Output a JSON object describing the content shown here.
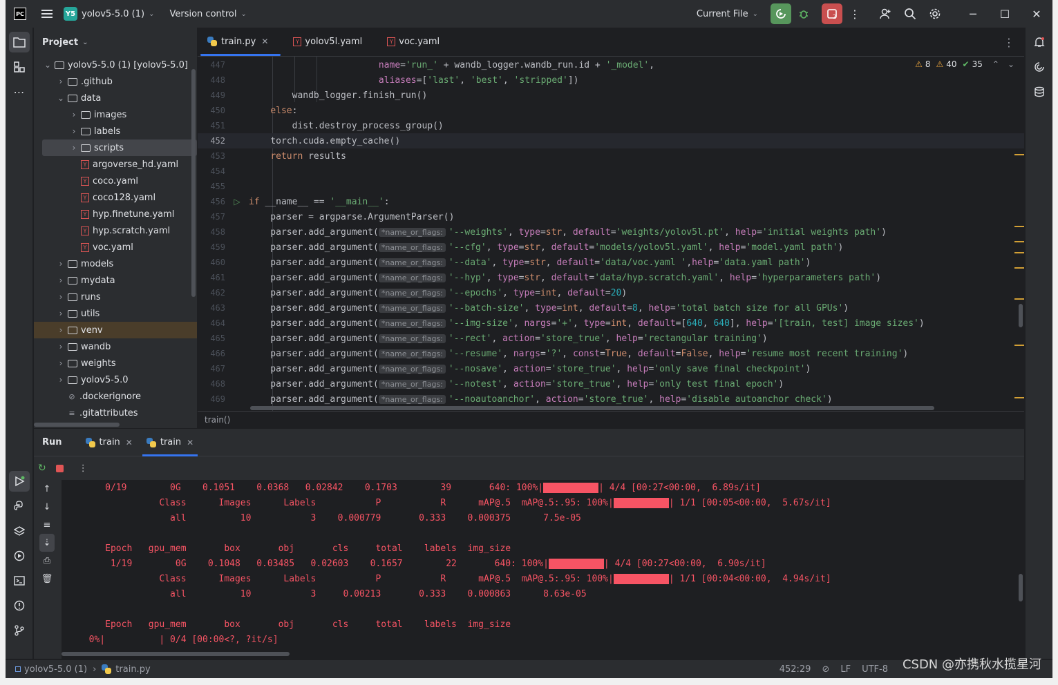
{
  "titlebar": {
    "project_badge": "Y5",
    "project_name": "yolov5-5.0 (1)",
    "vcs": "Version control",
    "run_config": "Current File"
  },
  "project_panel": {
    "title": "Project",
    "tree": [
      {
        "label": "yolov5-5.0 (1)  [yolov5-5.0]",
        "type": "folder",
        "level": 0,
        "expanded": true
      },
      {
        "label": ".github",
        "type": "folder",
        "level": 1
      },
      {
        "label": "data",
        "type": "folder",
        "level": 1,
        "expanded": true
      },
      {
        "label": "images",
        "type": "folder",
        "level": 2
      },
      {
        "label": "labels",
        "type": "folder",
        "level": 2
      },
      {
        "label": "scripts",
        "type": "folder",
        "level": 2,
        "selected": true
      },
      {
        "label": "argoverse_hd.yaml",
        "type": "yaml",
        "level": 2
      },
      {
        "label": "coco.yaml",
        "type": "yaml",
        "level": 2
      },
      {
        "label": "coco128.yaml",
        "type": "yaml",
        "level": 2
      },
      {
        "label": "hyp.finetune.yaml",
        "type": "yaml",
        "level": 2
      },
      {
        "label": "hyp.scratch.yaml",
        "type": "yaml",
        "level": 2
      },
      {
        "label": "voc.yaml",
        "type": "yaml",
        "level": 2
      },
      {
        "label": "models",
        "type": "folder",
        "level": 1
      },
      {
        "label": "mydata",
        "type": "folder",
        "level": 1
      },
      {
        "label": "runs",
        "type": "folder",
        "level": 1
      },
      {
        "label": "utils",
        "type": "folder",
        "level": 1
      },
      {
        "label": "venv",
        "type": "folder",
        "level": 1,
        "venv": true
      },
      {
        "label": "wandb",
        "type": "folder",
        "level": 1
      },
      {
        "label": "weights",
        "type": "folder",
        "level": 1
      },
      {
        "label": "yolov5-5.0",
        "type": "folder",
        "level": 1
      },
      {
        "label": ".dockerignore",
        "type": "ignore",
        "level": 1
      },
      {
        "label": ".gitattributes",
        "type": "text",
        "level": 1
      }
    ]
  },
  "editor": {
    "tabs": [
      {
        "label": "train.py",
        "kind": "py",
        "active": true
      },
      {
        "label": "yolov5l.yaml",
        "kind": "yaml"
      },
      {
        "label": "voc.yaml",
        "kind": "yaml"
      }
    ],
    "inspections": {
      "warnings1": "8",
      "warnings2": "40",
      "ok": "35"
    },
    "current_line": "452",
    "breadcrumb": "train()",
    "hint_label": "*name_or_flags:",
    "lines": [
      {
        "n": "447",
        "html": "                        <span class='param'>name</span>=<span class='str'>'run_'</span> + wandb_logger.wandb_run.id + <span class='str'>'_model'</span>,"
      },
      {
        "n": "448",
        "html": "                        <span class='param'>aliases</span>=[<span class='str'>'last'</span>, <span class='str'>'best'</span>, <span class='str'>'stripped'</span>])"
      },
      {
        "n": "449",
        "html": "        wandb_logger.finish_run()"
      },
      {
        "n": "450",
        "html": "    <span class='kw'>else</span>:"
      },
      {
        "n": "451",
        "html": "        dist.destroy_process_group()"
      },
      {
        "n": "452",
        "html": "    torch.cuda.empty_cache()"
      },
      {
        "n": "453",
        "html": "    <span class='kw'>return</span> results"
      },
      {
        "n": "454",
        "html": ""
      },
      {
        "n": "455",
        "html": ""
      },
      {
        "n": "456",
        "html": "<span class='kw'>if</span> __name__ == <span class='str'>'__main__'</span>:",
        "run": true
      },
      {
        "n": "457",
        "html": "    parser = argparse.ArgumentParser()"
      },
      {
        "n": "458",
        "hint": true,
        "html": "<span class='str'>'--weights'</span>, <span class='param'>type</span>=<span class='kw'>str</span>, <span class='param'>default</span>=<span class='str'>'weights/yolov5l.pt'</span>, <span class='param'>help</span>=<span class='str'>'initial weights path'</span>)"
      },
      {
        "n": "459",
        "hint": true,
        "html": "<span class='str'>'--cfg'</span>, <span class='param'>type</span>=<span class='kw'>str</span>, <span class='param'>default</span>=<span class='str'>'models/yolov5l.yaml'</span>, <span class='param'>help</span>=<span class='str'>'model.yaml path'</span>)"
      },
      {
        "n": "460",
        "hint": true,
        "html": "<span class='str'>'--data'</span>, <span class='param'>type</span>=<span class='kw'>str</span>, <span class='param'>default</span>=<span class='str'>'data/voc.yaml '</span>,<span class='param'>help</span>=<span class='str'>'data.yaml path'</span>)"
      },
      {
        "n": "461",
        "hint": true,
        "html": "<span class='str'>'--hyp'</span>, <span class='param'>type</span>=<span class='kw'>str</span>, <span class='param'>default</span>=<span class='str'>'data/hyp.scratch.yaml'</span>, <span class='param'>help</span>=<span class='str'>'hyperparameters path'</span>)"
      },
      {
        "n": "462",
        "hint": true,
        "html": "<span class='str'>'--epochs'</span>, <span class='param'>type</span>=<span class='kw'>int</span>, <span class='param'>default</span>=<span class='num'>20</span>)"
      },
      {
        "n": "463",
        "hint": true,
        "html": "<span class='str'>'--batch-size'</span>, <span class='param'>type</span>=<span class='kw'>int</span>, <span class='param'>default</span>=<span class='num'>8</span>, <span class='param'>help</span>=<span class='str'>'total batch size for all GPUs'</span>)"
      },
      {
        "n": "464",
        "hint": true,
        "html": "<span class='str'>'--img-size'</span>, <span class='param'>nargs</span>=<span class='str'>'+'</span>, <span class='param'>type</span>=<span class='kw'>int</span>, <span class='param'>default</span>=[<span class='num'>640</span>, <span class='num'>640</span>], <span class='param'>help</span>=<span class='str'>'[train, test] image sizes'</span>)"
      },
      {
        "n": "465",
        "hint": true,
        "html": "<span class='str'>'--rect'</span>, <span class='param'>action</span>=<span class='str'>'store_true'</span>, <span class='param'>help</span>=<span class='str'>'rectangular training'</span>)"
      },
      {
        "n": "466",
        "hint": true,
        "html": "<span class='str'>'--resume'</span>, <span class='param'>nargs</span>=<span class='str'>'?'</span>, <span class='param'>const</span>=<span class='kw'>True</span>, <span class='param'>default</span>=<span class='kw'>False</span>, <span class='param'>help</span>=<span class='str'>'resume most recent training'</span>)"
      },
      {
        "n": "467",
        "hint": true,
        "html": "<span class='str'>'--nosave'</span>, <span class='param'>action</span>=<span class='str'>'store_true'</span>, <span class='param'>help</span>=<span class='str'>'only save final checkpoint'</span>)"
      },
      {
        "n": "468",
        "hint": true,
        "html": "<span class='str'>'--notest'</span>, <span class='param'>action</span>=<span class='str'>'store_true'</span>, <span class='param'>help</span>=<span class='str'>'only test final epoch'</span>)"
      },
      {
        "n": "469",
        "hint": true,
        "html": "<span class='str'>'--noautoanchor'</span>, <span class='param'>action</span>=<span class='str'>'store_true'</span>, <span class='param'>help</span>=<span class='str'>'disable autoanchor check'</span>)"
      }
    ]
  },
  "run_panel": {
    "title": "Run",
    "tabs": [
      {
        "label": "train",
        "active": false
      },
      {
        "label": "train",
        "active": true
      }
    ],
    "console": [
      {
        "text": "     0/19        0G    0.1051    0.0368   0.02842    0.1703        39       640: 100%|",
        "bar": true,
        "tail": "| 4/4 [00:27<00:00,  6.89s/it]"
      },
      {
        "text": "               Class      Images      Labels           P           R      mAP@.5  mAP@.5:.95: 100%|",
        "bar": true,
        "tail": "| 1/1 [00:05<00:00,  5.67s/it]"
      },
      {
        "text": "                 all          10           3    0.000779       0.333    0.000375      7.5e-05"
      },
      {
        "text": ""
      },
      {
        "text": "     Epoch   gpu_mem       box       obj       cls     total    labels  img_size"
      },
      {
        "text": "      1/19        0G    0.1048   0.03485   0.02603    0.1657        22       640: 100%|",
        "bar": true,
        "tail": "| 4/4 [00:27<00:00,  6.90s/it]"
      },
      {
        "text": "               Class      Images      Labels           P           R      mAP@.5  mAP@.5:.95: 100%|",
        "bar": true,
        "tail": "| 1/1 [00:04<00:00,  4.94s/it]"
      },
      {
        "text": "                 all          10           3     0.00213       0.333    0.000863      8.63e-05"
      },
      {
        "text": ""
      },
      {
        "text": "     Epoch   gpu_mem       box       obj       cls     total    labels  img_size"
      },
      {
        "text": "  0%|          | 0/4 [00:00<?, ?it/s]"
      }
    ]
  },
  "statusbar": {
    "project": "yolov5-5.0 (1)",
    "file": "train.py",
    "position": "452:29",
    "line_sep": "LF",
    "encoding": "UTF-8",
    "watermark": "CSDN @亦携秋水揽星河"
  }
}
